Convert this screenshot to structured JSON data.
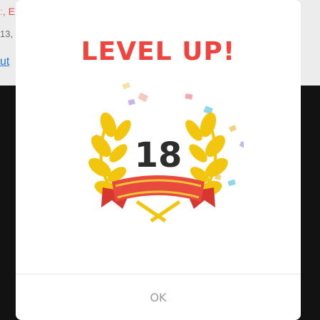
{
  "background": {
    "line1": "ː, E",
    "line2": "13,",
    "line3": "ut"
  },
  "modal": {
    "title": "LEVEL UP!",
    "level": "18",
    "ok_label": "OK"
  },
  "colors": {
    "title": "#f0443f",
    "laurel": "#f2c60f",
    "ribbon": "#e84a3d",
    "ribbon_stripe": "#f2c23b"
  },
  "icons": {
    "badge": "laurel-wreath-with-ribbon-icon",
    "confetti": "confetti-icon"
  }
}
